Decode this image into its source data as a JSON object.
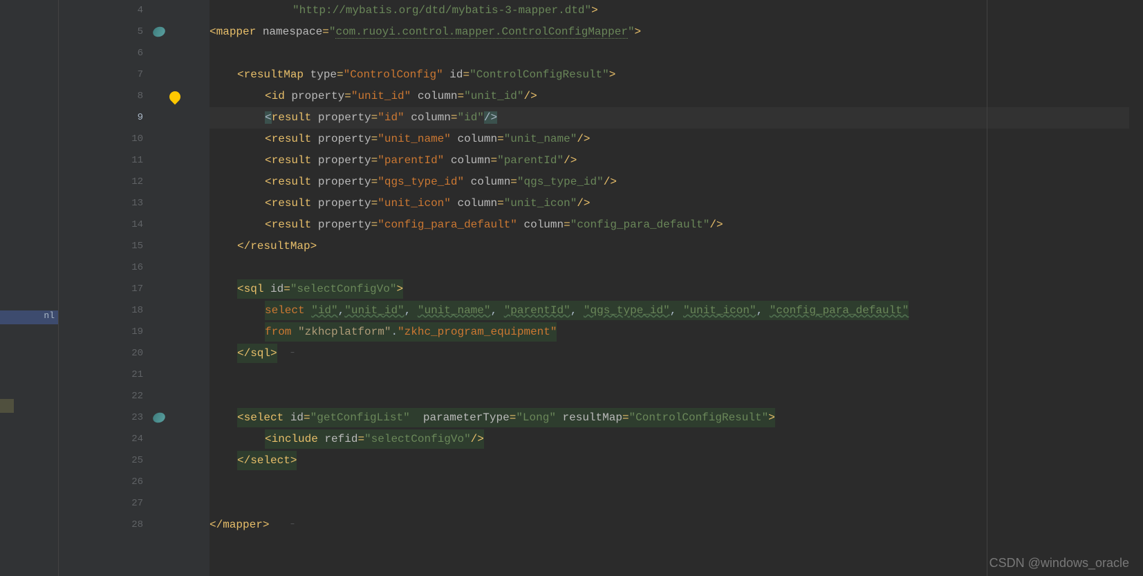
{
  "lines": [
    {
      "num": "4",
      "indent": "            ",
      "tokens": [
        {
          "c": "str",
          "t": "\"http://mybatis.org/dtd/mybatis-3-mapper.dtd\""
        },
        {
          "c": "punct",
          "t": ">"
        }
      ]
    },
    {
      "num": "5",
      "indent": "",
      "icon": "bean",
      "tokens": [
        {
          "c": "punct",
          "t": "<"
        },
        {
          "c": "tag",
          "t": "mapper "
        },
        {
          "c": "attr",
          "t": "namespace"
        },
        {
          "c": "punct",
          "t": "="
        },
        {
          "c": "str",
          "t": "\""
        },
        {
          "c": "wavy-ns",
          "t": "com.ruoyi.control.mapper.ControlConfigMapper"
        },
        {
          "c": "str",
          "t": "\""
        },
        {
          "c": "punct",
          "t": ">"
        }
      ]
    },
    {
      "num": "6",
      "indent": "",
      "tokens": []
    },
    {
      "num": "7",
      "indent": "    ",
      "tokens": [
        {
          "c": "punct",
          "t": "<"
        },
        {
          "c": "tag",
          "t": "resultMap "
        },
        {
          "c": "attr",
          "t": "type"
        },
        {
          "c": "punct",
          "t": "="
        },
        {
          "c": "str-orange",
          "t": "\"ControlConfig\""
        },
        {
          "c": "attr",
          "t": " id"
        },
        {
          "c": "punct",
          "t": "="
        },
        {
          "c": "str",
          "t": "\"ControlConfigResult\""
        },
        {
          "c": "punct",
          "t": ">"
        }
      ]
    },
    {
      "num": "8",
      "indent": "        ",
      "bulb": true,
      "tokens": [
        {
          "c": "punct",
          "t": "<"
        },
        {
          "c": "tag",
          "t": "id "
        },
        {
          "c": "attr",
          "t": "property"
        },
        {
          "c": "punct",
          "t": "="
        },
        {
          "c": "str-orange",
          "t": "\"unit_id\""
        },
        {
          "c": "attr",
          "t": " column"
        },
        {
          "c": "punct",
          "t": "="
        },
        {
          "c": "str",
          "t": "\"unit_id\""
        },
        {
          "c": "punct",
          "t": "/>"
        }
      ]
    },
    {
      "num": "9",
      "indent": "        ",
      "current": true,
      "tokens": [
        {
          "c": "highlight-bracket",
          "t": "<"
        },
        {
          "c": "tag",
          "t": "result "
        },
        {
          "c": "attr",
          "t": "property"
        },
        {
          "c": "punct",
          "t": "="
        },
        {
          "c": "str-orange",
          "t": "\"id\""
        },
        {
          "c": "attr",
          "t": " column"
        },
        {
          "c": "punct",
          "t": "="
        },
        {
          "c": "str",
          "t": "\"id\""
        },
        {
          "c": "highlight-bracket",
          "t": "/>"
        }
      ]
    },
    {
      "num": "10",
      "indent": "        ",
      "tokens": [
        {
          "c": "punct",
          "t": "<"
        },
        {
          "c": "tag",
          "t": "result "
        },
        {
          "c": "attr",
          "t": "property"
        },
        {
          "c": "punct",
          "t": "="
        },
        {
          "c": "str-orange",
          "t": "\"unit_name\""
        },
        {
          "c": "attr",
          "t": " column"
        },
        {
          "c": "punct",
          "t": "="
        },
        {
          "c": "str",
          "t": "\"unit_name\""
        },
        {
          "c": "punct",
          "t": "/>"
        }
      ]
    },
    {
      "num": "11",
      "indent": "        ",
      "tokens": [
        {
          "c": "punct",
          "t": "<"
        },
        {
          "c": "tag",
          "t": "result "
        },
        {
          "c": "attr",
          "t": "property"
        },
        {
          "c": "punct",
          "t": "="
        },
        {
          "c": "str-orange",
          "t": "\"parentId\""
        },
        {
          "c": "attr",
          "t": " column"
        },
        {
          "c": "punct",
          "t": "="
        },
        {
          "c": "str",
          "t": "\"parentId\""
        },
        {
          "c": "punct",
          "t": "/>"
        }
      ]
    },
    {
      "num": "12",
      "indent": "        ",
      "tokens": [
        {
          "c": "punct",
          "t": "<"
        },
        {
          "c": "tag",
          "t": "result "
        },
        {
          "c": "attr",
          "t": "property"
        },
        {
          "c": "punct",
          "t": "="
        },
        {
          "c": "str-orange",
          "t": "\"qgs_type_id\""
        },
        {
          "c": "attr",
          "t": " column"
        },
        {
          "c": "punct",
          "t": "="
        },
        {
          "c": "str",
          "t": "\"qgs_type_id\""
        },
        {
          "c": "punct",
          "t": "/>"
        }
      ]
    },
    {
      "num": "13",
      "indent": "        ",
      "tokens": [
        {
          "c": "punct",
          "t": "<"
        },
        {
          "c": "tag",
          "t": "result "
        },
        {
          "c": "attr",
          "t": "property"
        },
        {
          "c": "punct",
          "t": "="
        },
        {
          "c": "str-orange",
          "t": "\"unit_icon\""
        },
        {
          "c": "attr",
          "t": " column"
        },
        {
          "c": "punct",
          "t": "="
        },
        {
          "c": "str",
          "t": "\"unit_icon\""
        },
        {
          "c": "punct",
          "t": "/>"
        }
      ]
    },
    {
      "num": "14",
      "indent": "        ",
      "tokens": [
        {
          "c": "punct",
          "t": "<"
        },
        {
          "c": "tag",
          "t": "result "
        },
        {
          "c": "attr",
          "t": "property"
        },
        {
          "c": "punct",
          "t": "="
        },
        {
          "c": "str-orange",
          "t": "\"config_para_default\""
        },
        {
          "c": "attr",
          "t": " column"
        },
        {
          "c": "punct",
          "t": "="
        },
        {
          "c": "str",
          "t": "\"config_para_default\""
        },
        {
          "c": "punct",
          "t": "/>"
        }
      ]
    },
    {
      "num": "15",
      "indent": "    ",
      "tokens": [
        {
          "c": "punct",
          "t": "</"
        },
        {
          "c": "tag",
          "t": "resultMap"
        },
        {
          "c": "punct",
          "t": ">"
        }
      ]
    },
    {
      "num": "16",
      "indent": "",
      "tokens": []
    },
    {
      "num": "17",
      "indent": "    ",
      "sql": true,
      "tokens": [
        {
          "c": "punct",
          "t": "<"
        },
        {
          "c": "tag",
          "t": "sql "
        },
        {
          "c": "attr",
          "t": "id"
        },
        {
          "c": "punct",
          "t": "="
        },
        {
          "c": "str",
          "t": "\"selectConfigVo\""
        },
        {
          "c": "punct",
          "t": ">"
        }
      ]
    },
    {
      "num": "18",
      "indent": "        ",
      "sql": true,
      "tokens": [
        {
          "c": "kw",
          "t": "select "
        },
        {
          "c": "col-green-underline",
          "t": "\"id\""
        },
        {
          "c": "txt",
          "t": ","
        },
        {
          "c": "col-green-underline",
          "t": "\"unit_id\""
        },
        {
          "c": "txt",
          "t": ", "
        },
        {
          "c": "col-green-underline",
          "t": "\"unit_name\""
        },
        {
          "c": "txt",
          "t": ", "
        },
        {
          "c": "col-green-underline",
          "t": "\"parentId\""
        },
        {
          "c": "txt",
          "t": ", "
        },
        {
          "c": "col-green-underline",
          "t": "\"qgs_type_id\""
        },
        {
          "c": "txt",
          "t": ", "
        },
        {
          "c": "col-green-underline",
          "t": "\"unit_icon\""
        },
        {
          "c": "txt",
          "t": ", "
        },
        {
          "c": "col-green-underline",
          "t": "\"config_para_default\""
        }
      ]
    },
    {
      "num": "19",
      "indent": "        ",
      "sql": true,
      "tokens": [
        {
          "c": "kw",
          "t": "from "
        },
        {
          "c": "str-table",
          "t": "\"zkhcplatform\""
        },
        {
          "c": "txt",
          "t": "."
        },
        {
          "c": "str-orange",
          "t": "\"zkhc_program_equipment\""
        }
      ]
    },
    {
      "num": "20",
      "indent": "    ",
      "sql": true,
      "tokens": [
        {
          "c": "punct",
          "t": "</"
        },
        {
          "c": "tag",
          "t": "sql"
        },
        {
          "c": "punct",
          "t": ">"
        }
      ]
    },
    {
      "num": "21",
      "indent": "",
      "tokens": []
    },
    {
      "num": "22",
      "indent": "",
      "tokens": []
    },
    {
      "num": "23",
      "indent": "    ",
      "sql": true,
      "icon": "bean",
      "tokens": [
        {
          "c": "punct",
          "t": "<"
        },
        {
          "c": "tag",
          "t": "select "
        },
        {
          "c": "attr",
          "t": "id"
        },
        {
          "c": "punct",
          "t": "="
        },
        {
          "c": "str",
          "t": "\"getConfigList\""
        },
        {
          "c": "attr",
          "t": "  parameterType"
        },
        {
          "c": "punct",
          "t": "="
        },
        {
          "c": "str",
          "t": "\"Long\""
        },
        {
          "c": "attr",
          "t": " resultMap"
        },
        {
          "c": "punct",
          "t": "="
        },
        {
          "c": "str",
          "t": "\"ControlConfigResult\""
        },
        {
          "c": "punct",
          "t": ">"
        }
      ]
    },
    {
      "num": "24",
      "indent": "        ",
      "sql": true,
      "tokens": [
        {
          "c": "punct",
          "t": "<"
        },
        {
          "c": "tag",
          "t": "include "
        },
        {
          "c": "attr",
          "t": "refid"
        },
        {
          "c": "punct",
          "t": "="
        },
        {
          "c": "str",
          "t": "\"selectConfigVo\""
        },
        {
          "c": "punct",
          "t": "/>"
        }
      ]
    },
    {
      "num": "25",
      "indent": "    ",
      "sql": true,
      "tokens": [
        {
          "c": "punct",
          "t": "</"
        },
        {
          "c": "tag",
          "t": "select"
        },
        {
          "c": "punct",
          "t": ">"
        }
      ]
    },
    {
      "num": "26",
      "indent": "",
      "tokens": []
    },
    {
      "num": "27",
      "indent": "",
      "tokens": []
    },
    {
      "num": "28",
      "indent": "",
      "tokens": [
        {
          "c": "punct",
          "t": "</"
        },
        {
          "c": "tag",
          "t": "mapper"
        },
        {
          "c": "punct",
          "t": ">"
        }
      ]
    }
  ],
  "sidebar": {
    "item_label": "nl"
  },
  "watermark": "CSDN @windows_oracle"
}
